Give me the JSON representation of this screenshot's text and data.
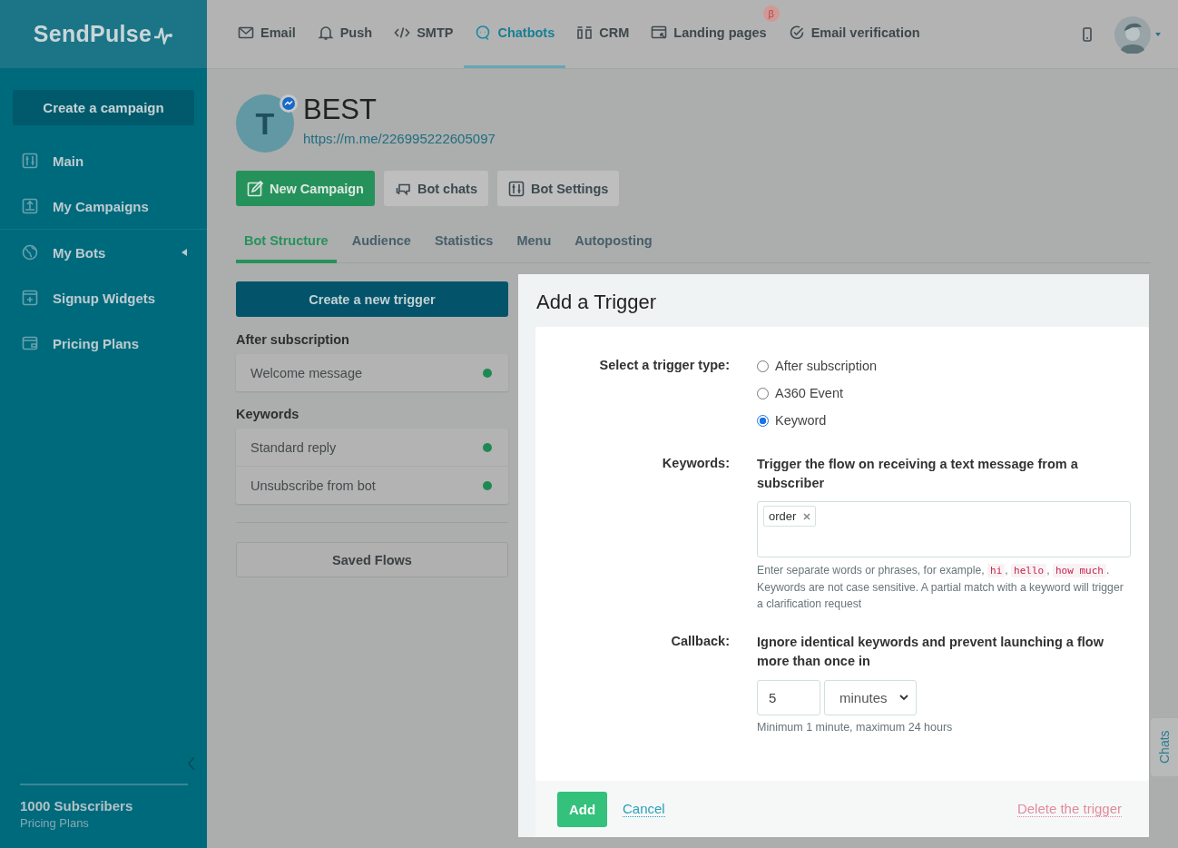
{
  "logo": "SendPulse",
  "sidebar": {
    "create_button": "Create a campaign",
    "items": [
      {
        "label": "Main",
        "has_caret": false
      },
      {
        "label": "My Campaigns",
        "has_caret": false
      },
      {
        "label": "My Bots",
        "has_caret": true
      },
      {
        "label": "Signup Widgets",
        "has_caret": false
      },
      {
        "label": "Pricing Plans",
        "has_caret": false
      }
    ],
    "subscribers": "1000 Subscribers",
    "plan_link": "Pricing Plans"
  },
  "topnav": [
    {
      "label": "Email",
      "selected": false
    },
    {
      "label": "Push",
      "selected": false
    },
    {
      "label": "SMTP",
      "selected": false
    },
    {
      "label": "Chatbots",
      "selected": true
    },
    {
      "label": "CRM",
      "selected": false
    },
    {
      "label": "Landing pages",
      "selected": false,
      "badge": "β"
    },
    {
      "label": "Email verification",
      "selected": false
    }
  ],
  "bot": {
    "avatar_letter": "T",
    "name": "BEST",
    "link": "https://m.me/226995222605097"
  },
  "actions": [
    {
      "label": "New Campaign",
      "kind": "primary"
    },
    {
      "label": "Bot chats",
      "kind": "secondary"
    },
    {
      "label": "Bot Settings",
      "kind": "secondary"
    }
  ],
  "tabs": [
    {
      "label": "Bot Structure",
      "selected": true
    },
    {
      "label": "Audience",
      "selected": false
    },
    {
      "label": "Statistics",
      "selected": false
    },
    {
      "label": "Menu",
      "selected": false
    },
    {
      "label": "Autoposting",
      "selected": false
    }
  ],
  "create_trigger": "Create a new trigger",
  "groups": [
    {
      "title": "After subscription",
      "flows": [
        {
          "name": "Welcome message",
          "color": "#1e8a52"
        }
      ]
    },
    {
      "title": "Keywords",
      "flows": [
        {
          "name": "Standard reply",
          "color": "#1e8a52"
        },
        {
          "name": "Unsubscribe from bot",
          "color": "#1e8a52"
        }
      ]
    }
  ],
  "saved_flows": "Saved Flows",
  "modal": {
    "title": "Add a Trigger",
    "type_label": "Select a trigger type:",
    "types": [
      {
        "label": "After subscription",
        "selected": false
      },
      {
        "label": "A360 Event",
        "selected": false
      },
      {
        "label": "Keyword",
        "selected": true
      }
    ],
    "keywords_label": "Keywords:",
    "keywords_desc": "Trigger the flow on receiving a text message from a subscriber",
    "tags": [
      "order"
    ],
    "hint": [
      {
        "kind": "text",
        "text": "Enter separate words or phrases, for example, "
      },
      {
        "kind": "code",
        "text": "hi"
      },
      {
        "kind": "text",
        "text": ", "
      },
      {
        "kind": "code",
        "text": "hello"
      },
      {
        "kind": "text",
        "text": ", "
      },
      {
        "kind": "code",
        "text": "how much"
      },
      {
        "kind": "text",
        "text": ". Keywords are not case sensitive. A partial match with a keyword will trigger a clarification request"
      }
    ],
    "callback_label": "Callback:",
    "callback_desc": "Ignore identical keywords and prevent launching a flow more than once in",
    "callback_value": "5",
    "callback_unit": "minutes",
    "callback_note": "Minimum 1 minute, maximum 24 hours",
    "add": "Add",
    "cancel": "Cancel",
    "delete": "Delete the trigger"
  },
  "chats_tab": "Chats"
}
